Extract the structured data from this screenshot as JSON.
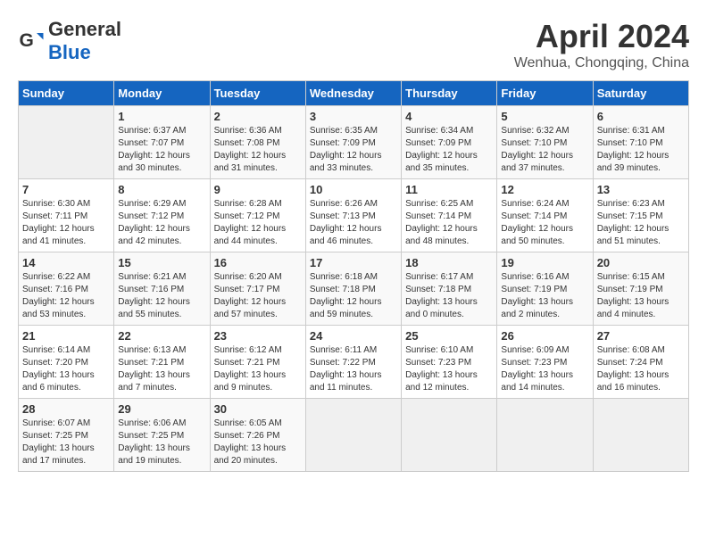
{
  "header": {
    "logo_text_general": "General",
    "logo_text_blue": "Blue",
    "month_year": "April 2024",
    "location": "Wenhua, Chongqing, China"
  },
  "calendar": {
    "days_of_week": [
      "Sunday",
      "Monday",
      "Tuesday",
      "Wednesday",
      "Thursday",
      "Friday",
      "Saturday"
    ],
    "weeks": [
      [
        {
          "day": "",
          "info": ""
        },
        {
          "day": "1",
          "info": "Sunrise: 6:37 AM\nSunset: 7:07 PM\nDaylight: 12 hours\nand 30 minutes."
        },
        {
          "day": "2",
          "info": "Sunrise: 6:36 AM\nSunset: 7:08 PM\nDaylight: 12 hours\nand 31 minutes."
        },
        {
          "day": "3",
          "info": "Sunrise: 6:35 AM\nSunset: 7:09 PM\nDaylight: 12 hours\nand 33 minutes."
        },
        {
          "day": "4",
          "info": "Sunrise: 6:34 AM\nSunset: 7:09 PM\nDaylight: 12 hours\nand 35 minutes."
        },
        {
          "day": "5",
          "info": "Sunrise: 6:32 AM\nSunset: 7:10 PM\nDaylight: 12 hours\nand 37 minutes."
        },
        {
          "day": "6",
          "info": "Sunrise: 6:31 AM\nSunset: 7:10 PM\nDaylight: 12 hours\nand 39 minutes."
        }
      ],
      [
        {
          "day": "7",
          "info": "Sunrise: 6:30 AM\nSunset: 7:11 PM\nDaylight: 12 hours\nand 41 minutes."
        },
        {
          "day": "8",
          "info": "Sunrise: 6:29 AM\nSunset: 7:12 PM\nDaylight: 12 hours\nand 42 minutes."
        },
        {
          "day": "9",
          "info": "Sunrise: 6:28 AM\nSunset: 7:12 PM\nDaylight: 12 hours\nand 44 minutes."
        },
        {
          "day": "10",
          "info": "Sunrise: 6:26 AM\nSunset: 7:13 PM\nDaylight: 12 hours\nand 46 minutes."
        },
        {
          "day": "11",
          "info": "Sunrise: 6:25 AM\nSunset: 7:14 PM\nDaylight: 12 hours\nand 48 minutes."
        },
        {
          "day": "12",
          "info": "Sunrise: 6:24 AM\nSunset: 7:14 PM\nDaylight: 12 hours\nand 50 minutes."
        },
        {
          "day": "13",
          "info": "Sunrise: 6:23 AM\nSunset: 7:15 PM\nDaylight: 12 hours\nand 51 minutes."
        }
      ],
      [
        {
          "day": "14",
          "info": "Sunrise: 6:22 AM\nSunset: 7:16 PM\nDaylight: 12 hours\nand 53 minutes."
        },
        {
          "day": "15",
          "info": "Sunrise: 6:21 AM\nSunset: 7:16 PM\nDaylight: 12 hours\nand 55 minutes."
        },
        {
          "day": "16",
          "info": "Sunrise: 6:20 AM\nSunset: 7:17 PM\nDaylight: 12 hours\nand 57 minutes."
        },
        {
          "day": "17",
          "info": "Sunrise: 6:18 AM\nSunset: 7:18 PM\nDaylight: 12 hours\nand 59 minutes."
        },
        {
          "day": "18",
          "info": "Sunrise: 6:17 AM\nSunset: 7:18 PM\nDaylight: 13 hours\nand 0 minutes."
        },
        {
          "day": "19",
          "info": "Sunrise: 6:16 AM\nSunset: 7:19 PM\nDaylight: 13 hours\nand 2 minutes."
        },
        {
          "day": "20",
          "info": "Sunrise: 6:15 AM\nSunset: 7:19 PM\nDaylight: 13 hours\nand 4 minutes."
        }
      ],
      [
        {
          "day": "21",
          "info": "Sunrise: 6:14 AM\nSunset: 7:20 PM\nDaylight: 13 hours\nand 6 minutes."
        },
        {
          "day": "22",
          "info": "Sunrise: 6:13 AM\nSunset: 7:21 PM\nDaylight: 13 hours\nand 7 minutes."
        },
        {
          "day": "23",
          "info": "Sunrise: 6:12 AM\nSunset: 7:21 PM\nDaylight: 13 hours\nand 9 minutes."
        },
        {
          "day": "24",
          "info": "Sunrise: 6:11 AM\nSunset: 7:22 PM\nDaylight: 13 hours\nand 11 minutes."
        },
        {
          "day": "25",
          "info": "Sunrise: 6:10 AM\nSunset: 7:23 PM\nDaylight: 13 hours\nand 12 minutes."
        },
        {
          "day": "26",
          "info": "Sunrise: 6:09 AM\nSunset: 7:23 PM\nDaylight: 13 hours\nand 14 minutes."
        },
        {
          "day": "27",
          "info": "Sunrise: 6:08 AM\nSunset: 7:24 PM\nDaylight: 13 hours\nand 16 minutes."
        }
      ],
      [
        {
          "day": "28",
          "info": "Sunrise: 6:07 AM\nSunset: 7:25 PM\nDaylight: 13 hours\nand 17 minutes."
        },
        {
          "day": "29",
          "info": "Sunrise: 6:06 AM\nSunset: 7:25 PM\nDaylight: 13 hours\nand 19 minutes."
        },
        {
          "day": "30",
          "info": "Sunrise: 6:05 AM\nSunset: 7:26 PM\nDaylight: 13 hours\nand 20 minutes."
        },
        {
          "day": "",
          "info": ""
        },
        {
          "day": "",
          "info": ""
        },
        {
          "day": "",
          "info": ""
        },
        {
          "day": "",
          "info": ""
        }
      ]
    ]
  }
}
